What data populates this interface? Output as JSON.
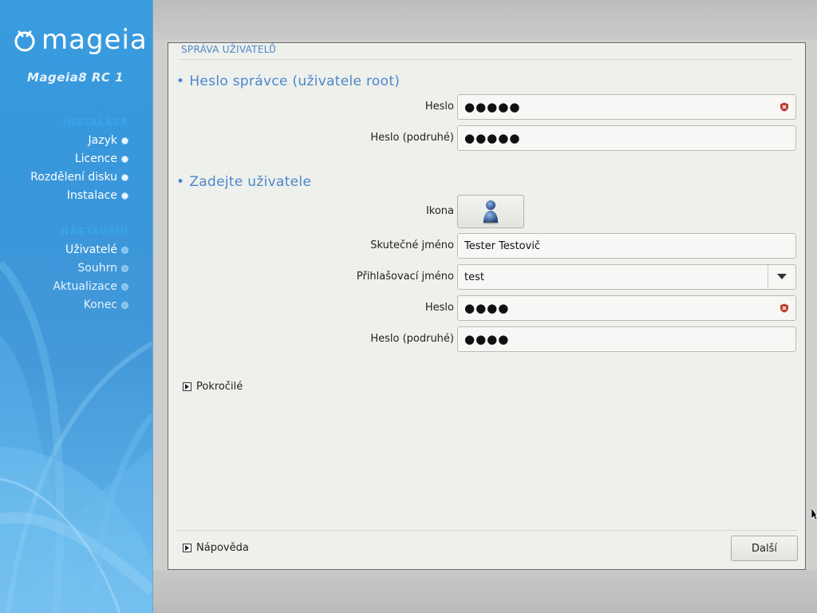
{
  "sidebar": {
    "logo_text": "mageia",
    "version": "Mageia8 RC 1",
    "groups": [
      {
        "title": "Instalace",
        "steps": [
          {
            "label": "Jazyk",
            "state": "done"
          },
          {
            "label": "Licence",
            "state": "done"
          },
          {
            "label": "Rozdělení disku",
            "state": "done"
          },
          {
            "label": "Instalace",
            "state": "done"
          }
        ]
      },
      {
        "title": "Nastavení",
        "steps": [
          {
            "label": "Uživatelé",
            "state": "current"
          },
          {
            "label": "Souhrn",
            "state": "pending"
          },
          {
            "label": "Aktualizace",
            "state": "pending"
          },
          {
            "label": "Konec",
            "state": "pending"
          }
        ]
      }
    ]
  },
  "panel": {
    "title": "SPRÁVA UŽIVATELŮ",
    "root_section": {
      "title": "Heslo správce (uživatele root)",
      "password_label": "Heslo",
      "password_value": "●●●●●",
      "password2_label": "Heslo (podruhé)",
      "password2_value": "●●●●●"
    },
    "user_section": {
      "title": "Zadejte uživatele",
      "icon_label": "Ikona",
      "realname_label": "Skutečné jméno",
      "realname_value": "Tester Testovič",
      "login_label": "Přihlašovací jméno",
      "login_value": "test",
      "password_label": "Heslo",
      "password_value": "●●●●",
      "password2_label": "Heslo (podruhé)",
      "password2_value": "●●●●"
    },
    "advanced_label": "Pokročilé",
    "help_label": "Nápověda",
    "next_label": "Další"
  },
  "colors": {
    "accent": "#4c86cb",
    "sidebar_blue": "#2f8fd6",
    "panel_bg": "#eef0ec",
    "warning_red": "#c0392b"
  },
  "icons": {
    "field_warning": "weak-password-shield-icon",
    "user_avatar": "user-avatar-icon",
    "combo": "chevron-down-icon",
    "expander": "triangle-right-icon"
  }
}
